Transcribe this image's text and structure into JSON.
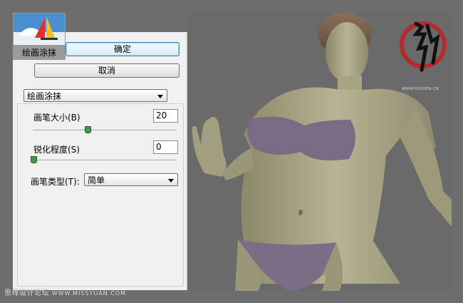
{
  "dialog": {
    "thumbnail_label": "绘画涂抹",
    "ok_label": "确定",
    "cancel_label": "取消",
    "filter_select": "绘画涂抹",
    "brush_size_label": "画笔大小(B)",
    "brush_size_value": "20",
    "brush_size_level": 0.39,
    "sharpness_label": "锐化程度(S)",
    "sharpness_value": "0",
    "sharpness_level": 0.0,
    "brush_type_label": "画笔类型(T):",
    "brush_type_value": "简单"
  },
  "watermark": {
    "site_name": "思缘设计论坛",
    "site_url": "WWW.MISSYUAN.COM"
  },
  "logo": {
    "url_text": "WWW.HSSHEN.CN"
  },
  "colors": {
    "frame": "#6d6d6d",
    "panel": "#f0f0f0",
    "slider_knob": "#3a9a4a",
    "default_button_border": "#3c7fb1"
  }
}
